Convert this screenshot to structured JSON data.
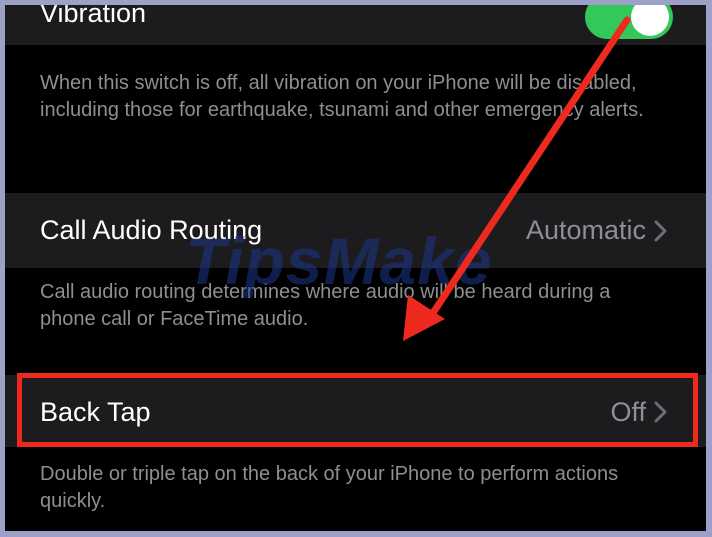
{
  "settings": {
    "vibration": {
      "label": "Vibration",
      "enabled": true,
      "footer": "When this switch is off, all vibration on your iPhone will be disabled, including those for earthquake, tsunami and other emergency alerts."
    },
    "call_audio_routing": {
      "label": "Call Audio Routing",
      "value": "Automatic",
      "footer": "Call audio routing determines where audio will be heard during a phone call or FaceTime audio."
    },
    "back_tap": {
      "label": "Back Tap",
      "value": "Off",
      "footer": "Double or triple tap on the back of your iPhone to perform actions quickly."
    }
  },
  "watermark": "TipsMake",
  "colors": {
    "toggle_on": "#34c759",
    "annotation": "#ee2a1f",
    "row_bg": "#1c1c1e",
    "secondary_text": "#8e8e93"
  },
  "icons": [
    "chevron-right-icon",
    "chevron-right-icon"
  ]
}
